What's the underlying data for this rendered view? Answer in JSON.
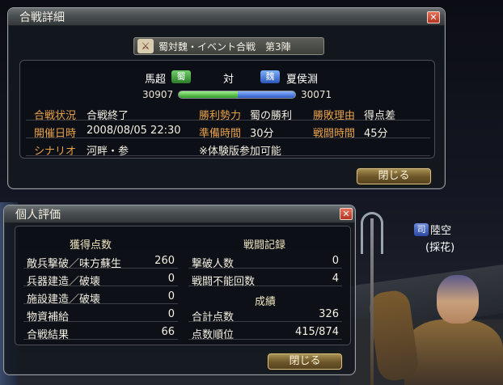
{
  "main_window": {
    "title": "合戦詳細",
    "battle_name": "蜀対魏・イベント合戦",
    "stage": "第3陣",
    "left_force": {
      "commander": "馬超",
      "badge": "蜀",
      "score": "30907",
      "color": "#3fa53a"
    },
    "vs": "対",
    "right_force": {
      "commander": "夏侯淵",
      "badge": "魏",
      "score": "30071",
      "color": "#3462c8"
    },
    "score_share_left": 0.5068,
    "details": {
      "status_label": "合戦状況",
      "status_value": "合戦終了",
      "winner_label": "勝利勢力",
      "winner_value": "蜀の勝利",
      "reason_label": "勝敗理由",
      "reason_value": "得点差",
      "date_label": "開催日時",
      "date_value": "2008/08/05 22:30",
      "prep_label": "準備時間",
      "prep_value": "30分",
      "battle_time_label": "戦闘時間",
      "battle_time_value": "45分",
      "scenario_label": "シナリオ",
      "scenario_value": "河畔・参",
      "trial_note": "※体験版参加可能"
    },
    "close_label": "閉じる"
  },
  "personal_window": {
    "title": "個人評価",
    "points_header": "獲得点数",
    "points": [
      {
        "label": "敵兵撃破／味方蘇生",
        "value": "260"
      },
      {
        "label": "兵器建造／破壊",
        "value": "0"
      },
      {
        "label": "施設建造／破壊",
        "value": "0"
      },
      {
        "label": "物資補給",
        "value": "0"
      },
      {
        "label": "合戦結果",
        "value": "66"
      }
    ],
    "record_header": "戦闘記録",
    "records": [
      {
        "label": "撃破人数",
        "value": "0"
      },
      {
        "label": "戦闘不能回数",
        "value": "4"
      }
    ],
    "results_header": "成績",
    "results": [
      {
        "label": "合計点数",
        "value": "326"
      },
      {
        "label": "点数順位",
        "value": "415/874"
      }
    ],
    "close_label": "閉じる"
  },
  "character": {
    "badge": "司",
    "name": "陸空",
    "title": "(採花)"
  },
  "colors": {
    "label_orange": "#e9a24a",
    "shu_green": "#3fa53a",
    "wei_blue": "#3462c8"
  }
}
